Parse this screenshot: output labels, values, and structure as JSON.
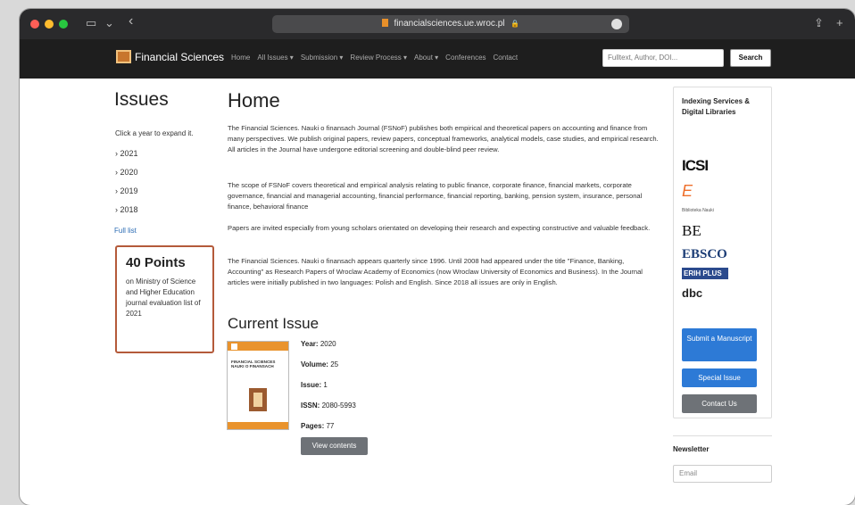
{
  "browser": {
    "url": "financialsciences.ue.wroc.pl"
  },
  "nav": {
    "brand": "Financial Sciences",
    "links": [
      "Home",
      "All Issues ▾",
      "Submission ▾",
      "Review Process ▾",
      "About ▾",
      "Conferences",
      "Contact"
    ],
    "search_placeholder": "Fulltext, Author, DOI...",
    "search_button": "Search"
  },
  "left": {
    "title": "Issues",
    "instruction": "Click a year to expand it.",
    "years": [
      "› 2021",
      "› 2020",
      "› 2019",
      "› 2018"
    ],
    "full_list": "Full list",
    "points_title": "40 Points",
    "points_text": "on Ministry of Science and Higher Education journal evaluation list of 2021"
  },
  "main": {
    "title": "Home",
    "paragraphs": [
      "The Financial Sciences. Nauki o finansach Journal (FSNoF) publishes both empirical and theoretical papers on accounting and finance from many perspectives. We publish original papers, review papers, conceptual frameworks, analytical models, case studies, and empirical research. All articles in the Journal have undergone editorial screening and double-blind peer review.",
      "The scope of FSNoF covers theoretical and empirical analysis relating to public finance, corporate finance, financial markets, corporate governance, financial and managerial accounting, financial performance, financial reporting, banking, pension system, insurance, personal finance, behavioral finance",
      "Papers are invited especially from young scholars orientated on developing their research and expecting constructive and valuable feedback.",
      "The Financial Sciences. Nauki o finansach appears quarterly since 1996. Until 2008 had appeared under the title \"Finance, Banking, Accounting\" as Research Papers of Wroclaw Academy of Economics (now Wroclaw University of Economics and Business). In the Journal articles were initially published in two languages: Polish and English. Since 2018 all issues are only in English."
    ],
    "current_issue_title": "Current Issue",
    "cover_text": "FINANCIAL SCIENCES NAUKI O FINANSACH",
    "year_label": "Year:",
    "year": "2020",
    "volume_label": "Volume:",
    "volume": "25",
    "issue_label": "Issue:",
    "issue": "1",
    "issn_label": "ISSN:",
    "issn": "2080-5993",
    "pages_label": "Pages:",
    "pages": "77",
    "view_button": "View contents"
  },
  "sidebar": {
    "indexing_title": "Indexing Services & Digital Libraries",
    "logos": [
      "ICSI",
      "E",
      "Biblioteka Nauki",
      "BE",
      "EBSCO",
      "ERIH PLUS",
      "dbc"
    ],
    "submit_button": "Submit a Manuscript",
    "special_button": "Special Issue",
    "contact_button": "Contact Us",
    "newsletter_title": "Newsletter",
    "email_placeholder": "Email"
  }
}
